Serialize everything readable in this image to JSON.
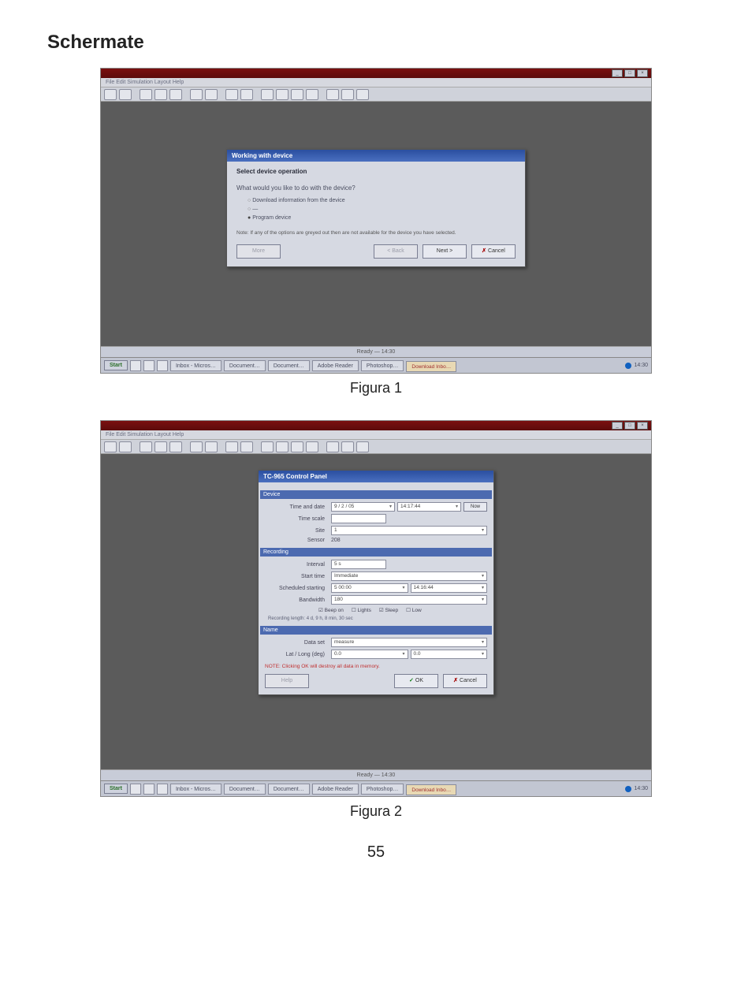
{
  "page": {
    "section_title": "Schermate",
    "figure1_caption": "Figura 1",
    "figure2_caption": "Figura 2",
    "page_number": "55"
  },
  "app": {
    "title": "",
    "menubar": "File  Edit  Simulation  Layout  Help",
    "toolbar_groups": 12,
    "statusbar": "Ready  —  14:30",
    "win_min": "_",
    "win_max": "□",
    "win_close": "×"
  },
  "dialog1": {
    "title": "Working with device",
    "header": "Select device operation",
    "question": "What would you like to do with the device?",
    "opt1": "Download information from the device",
    "opt2": "—",
    "opt3": "Program device",
    "note": "Note: If any of the options are greyed out then are not available for the device you have selected.",
    "btn_more": "More",
    "btn_back": "< Back",
    "btn_next": "Next >",
    "btn_cancel": "Cancel"
  },
  "dialog2": {
    "title": "TC-965 Control Panel",
    "sec_device": "Device",
    "row_time": {
      "label": "Time and date",
      "value1": "9 / 2 / 05",
      "value2": "14:17:44",
      "btn": "Now"
    },
    "row_timescale": {
      "label": "Time scale",
      "value": ""
    },
    "row_site": {
      "label": "Site",
      "value": "1"
    },
    "row_sensor": {
      "label": "Sensor",
      "value": "208"
    },
    "sec_recording": "Recording",
    "row_interval": {
      "label": "Interval",
      "value": "5 s"
    },
    "row_starttime": {
      "label": "Start time",
      "value": "Immediate"
    },
    "row_schedule": {
      "label": "Scheduled starting",
      "value1": "5  00:00",
      "value2": "14:16:44"
    },
    "row_bandwidth": {
      "label": "Bandwidth",
      "value": "180"
    },
    "check_row": {
      "c1": "Beep on",
      "c2": "Lights",
      "c3": "Sleep",
      "c4": "Low"
    },
    "recording_note": "Recording length: 4 d, 9 h, 8 min, 30 sec",
    "sec_name": "Name",
    "row_dataset": {
      "label": "Data set",
      "value": "measure"
    },
    "row_location": {
      "label": "Lat / Long (deg)",
      "value1": "0.0",
      "value2": "0.0"
    },
    "warning": "NOTE: Clicking OK will destroy all data in memory.",
    "btn_help": "Help",
    "btn_ok": "OK",
    "btn_cancel": "Cancel"
  },
  "taskbar": {
    "start": "Start",
    "items": [
      {
        "label": "Inbox - Micros…",
        "active": false
      },
      {
        "label": "Document…",
        "active": false
      },
      {
        "label": "Document…",
        "active": false
      },
      {
        "label": "Adobe Reader",
        "active": false
      },
      {
        "label": "Photoshop…",
        "active": false
      },
      {
        "label": "Download Inbo…",
        "active": true,
        "warn": true
      }
    ],
    "clock": "14:30"
  }
}
